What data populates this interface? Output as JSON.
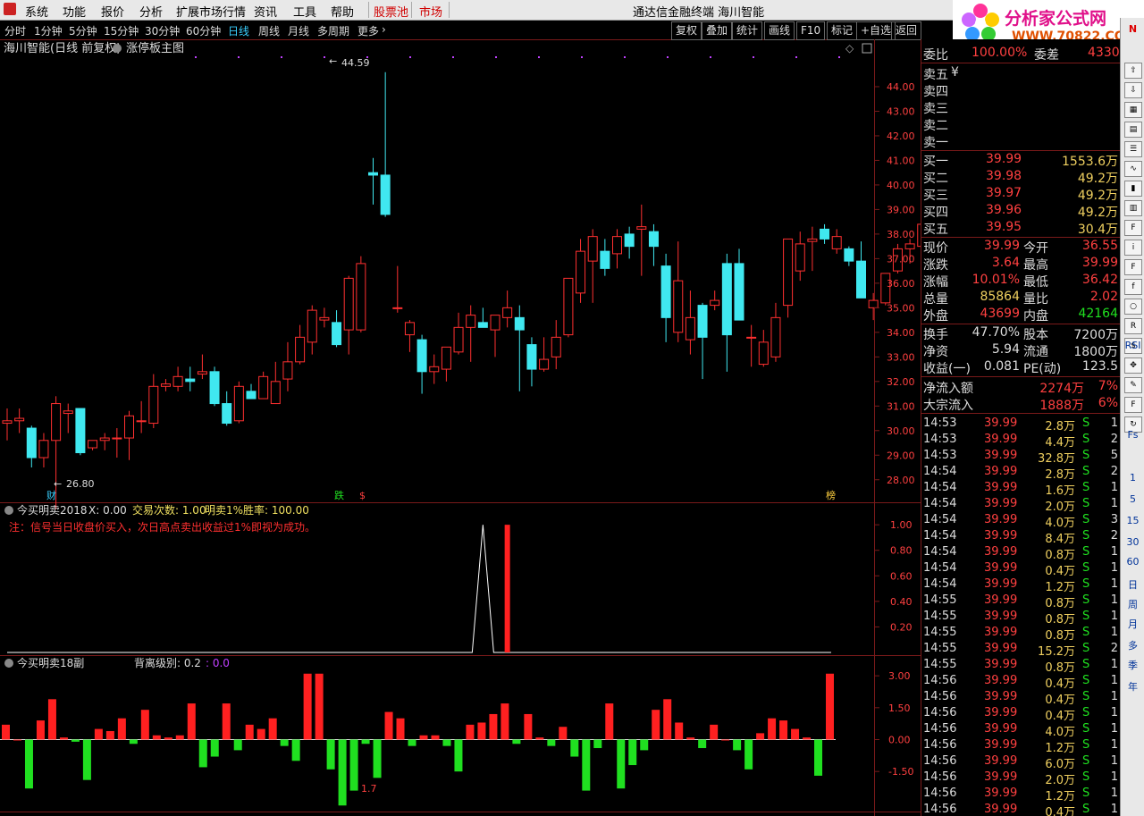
{
  "menu": {
    "items": [
      "系统",
      "功能",
      "报价",
      "分析",
      "扩展市场行情",
      "资讯",
      "工具",
      "帮助"
    ],
    "stock_pool": "股票池",
    "market": "市场",
    "title": "通达信金融终端 海川智能",
    "trade": "行"
  },
  "logo": {
    "title": "分析家公式网",
    "url": "WWW.70822.COM"
  },
  "period_bar": {
    "periods": [
      "分时",
      "1分钟",
      "5分钟",
      "15分钟",
      "30分钟",
      "60分钟",
      "日线",
      "周线",
      "月线",
      "多周期",
      "更多"
    ],
    "active": "日线",
    "buttons": [
      "复权",
      "叠加",
      "统计",
      "画线",
      "F10",
      "标记",
      "+自选",
      "返回"
    ]
  },
  "main_chart": {
    "stock_title": "海川智能(日线 前复权)",
    "template": "涨停板主图",
    "high_label": "44.59",
    "low_label": "26.80",
    "bottom_markers": [
      "财",
      "跌",
      "$",
      "榜"
    ]
  },
  "indicator1": {
    "name": "今买明卖2018",
    "x_label": "X: 0.00",
    "trades_label": "交易次数: 1.00",
    "winrate_label": "明卖1%胜率: 100.00",
    "note": "注：信号当日收盘价买入，次日高点卖出收益过1%即视为成功。",
    "ylabels": [
      "1.00",
      "0.80",
      "0.60",
      "0.40",
      "0.20"
    ]
  },
  "indicator2": {
    "name": "今买明卖18副",
    "level_label": "背离级别: 0.2",
    "level_value": ": 0.0",
    "annotation": "1.7",
    "ylabels": [
      "3.00",
      "1.50",
      "0.00",
      "-1.50"
    ]
  },
  "colors": {
    "up": "#ff3030",
    "down": "#40e8f0",
    "pos_bar": "#ff2020",
    "neg_bar": "#20e020",
    "border": "#7a1a1a"
  },
  "chart_data": [
    {
      "type": "candlestick",
      "title": "海川智能(日线 前复权)",
      "ylim": [
        27.3,
        45.2
      ],
      "yticks": [
        "44.00",
        "43.00",
        "42.00",
        "41.00",
        "40.00",
        "39.00",
        "38.00",
        "37.00",
        "36.00",
        "35.00",
        "34.00",
        "33.00",
        "32.00",
        "31.00",
        "30.00",
        "29.00",
        "28.00"
      ],
      "candles": [
        [
          30.3,
          30.9,
          29.6,
          30.4
        ],
        [
          30.4,
          30.9,
          29.9,
          30.5
        ],
        [
          30.1,
          30.2,
          28.5,
          28.9
        ],
        [
          28.9,
          29.9,
          28.5,
          29.6
        ],
        [
          29.6,
          31.4,
          26.8,
          31.1
        ],
        [
          30.7,
          31.1,
          29.9,
          30.8
        ],
        [
          30.9,
          30.9,
          29.0,
          29.1
        ],
        [
          29.3,
          29.6,
          29.2,
          29.6
        ],
        [
          29.6,
          29.9,
          29.2,
          29.7
        ],
        [
          29.7,
          30.1,
          28.9,
          29.7
        ],
        [
          29.7,
          30.8,
          28.8,
          30.6
        ],
        [
          30.4,
          31.2,
          29.9,
          30.4
        ],
        [
          30.3,
          32.3,
          30.1,
          31.8
        ],
        [
          31.8,
          32.1,
          31.6,
          31.9
        ],
        [
          31.8,
          32.6,
          31.6,
          32.2
        ],
        [
          32.1,
          32.6,
          31.6,
          32.0
        ],
        [
          32.3,
          33.1,
          32.1,
          32.4
        ],
        [
          32.4,
          32.6,
          31.0,
          31.1
        ],
        [
          31.1,
          31.6,
          30.2,
          30.3
        ],
        [
          30.4,
          32.0,
          30.3,
          31.8
        ],
        [
          31.6,
          31.9,
          31.4,
          31.3
        ],
        [
          31.3,
          32.4,
          31.3,
          32.2
        ],
        [
          31.1,
          32.8,
          31.2,
          32.0
        ],
        [
          32.1,
          33.6,
          31.6,
          32.8
        ],
        [
          32.8,
          34.3,
          32.7,
          33.8
        ],
        [
          33.6,
          35.1,
          33.1,
          34.9
        ],
        [
          34.5,
          35.0,
          34.2,
          34.6
        ],
        [
          34.4,
          34.9,
          33.4,
          33.5
        ],
        [
          34.1,
          36.3,
          33.1,
          36.2
        ],
        [
          34.1,
          37.1,
          34.0,
          36.8
        ],
        [
          40.5,
          41.1,
          39.2,
          40.4
        ],
        [
          40.4,
          44.59,
          38.7,
          38.8
        ],
        [
          35.0,
          36.7,
          34.8,
          35.0
        ],
        [
          33.9,
          34.5,
          33.2,
          34.4
        ],
        [
          33.7,
          33.9,
          31.5,
          32.4
        ],
        [
          32.4,
          33.1,
          31.9,
          32.6
        ],
        [
          32.5,
          32.9,
          32.0,
          33.4
        ],
        [
          33.2,
          34.8,
          33.1,
          34.2
        ],
        [
          34.2,
          35.1,
          32.8,
          34.7
        ],
        [
          34.4,
          35.0,
          34.3,
          34.2
        ],
        [
          34.1,
          34.5,
          33.0,
          34.7
        ],
        [
          34.6,
          35.7,
          34.2,
          35.0
        ],
        [
          34.6,
          35.1,
          31.6,
          34.1
        ],
        [
          33.5,
          33.8,
          31.8,
          32.5
        ],
        [
          32.5,
          33.8,
          32.4,
          32.9
        ],
        [
          33.0,
          34.5,
          32.5,
          33.8
        ],
        [
          33.9,
          36.2,
          33.8,
          36.2
        ],
        [
          35.6,
          37.8,
          35.2,
          37.3
        ],
        [
          36.9,
          38.2,
          35.2,
          37.9
        ],
        [
          37.3,
          37.8,
          36.3,
          36.6
        ],
        [
          37.2,
          38.2,
          36.6,
          37.9
        ],
        [
          38.0,
          38.3,
          37.0,
          37.5
        ],
        [
          38.2,
          39.2,
          36.3,
          38.3
        ],
        [
          38.1,
          38.4,
          36.7,
          37.5
        ],
        [
          36.7,
          37.2,
          33.6,
          34.6
        ],
        [
          34.0,
          37.7,
          33.6,
          36.1
        ],
        [
          33.7,
          35.7,
          33.1,
          34.6
        ],
        [
          35.1,
          35.2,
          32.1,
          33.8
        ],
        [
          35.1,
          35.7,
          34.9,
          35.3
        ],
        [
          36.8,
          37.2,
          32.4,
          33.9
        ],
        [
          36.8,
          37.4,
          34.5,
          34.5
        ],
        [
          33.8,
          34.3,
          32.6,
          33.8
        ],
        [
          32.7,
          34.1,
          32.6,
          33.6
        ],
        [
          33.0,
          35.2,
          32.8,
          34.6
        ],
        [
          35.1,
          37.7,
          34.6,
          37.8
        ],
        [
          36.5,
          38.1,
          36.1,
          37.6
        ],
        [
          37.7,
          38.3,
          36.5,
          37.8
        ],
        [
          38.2,
          38.4,
          37.6,
          37.8
        ],
        [
          37.4,
          38.2,
          37.2,
          37.9
        ],
        [
          37.4,
          37.5,
          36.7,
          36.9
        ],
        [
          36.9,
          37.7,
          35.5,
          35.4
        ],
        [
          35.0,
          35.6,
          34.5,
          35.3
        ],
        [
          35.2,
          36.4,
          35.1,
          36.4
        ],
        [
          36.5,
          37.6,
          36.4,
          37.4
        ],
        [
          37.4,
          37.8,
          36.8,
          37.6
        ],
        [
          37.5,
          39.8,
          37.3,
          38.4
        ],
        [
          38.4,
          39.5,
          36.1,
          36.4
        ],
        [
          36.5,
          40.0,
          36.5,
          40.0
        ]
      ]
    },
    {
      "type": "line",
      "title": "今买明卖2018",
      "ylim": [
        0,
        1.05
      ],
      "peak_index": 39,
      "peak_value": 1.0,
      "red_bar_index": 41,
      "red_bar_value": 1.0
    },
    {
      "type": "bar",
      "title": "今买明卖18副",
      "ylim": [
        -3.3,
        3.3
      ],
      "values": [
        0.7,
        0.0,
        -2.3,
        0.9,
        1.9,
        0.1,
        -0.1,
        -1.9,
        0.5,
        0.4,
        1.0,
        -0.2,
        1.4,
        0.2,
        0.1,
        0.2,
        1.7,
        -1.3,
        -0.8,
        1.7,
        -0.5,
        0.7,
        0.5,
        1.0,
        -0.3,
        -1.0,
        3.1,
        3.1,
        -1.4,
        -3.1,
        -2.4,
        -0.2,
        -1.8,
        1.3,
        1.0,
        -0.3,
        0.2,
        0.2,
        -0.3,
        -1.5,
        0.7,
        0.8,
        1.2,
        1.7,
        -0.2,
        1.2,
        0.1,
        -0.3,
        0.6,
        -0.8,
        -2.4,
        -0.4,
        1.7,
        -2.3,
        -1.2,
        -0.5,
        1.4,
        1.9,
        0.8,
        0.1,
        -0.4,
        0.7,
        0.0,
        -0.5,
        -1.4,
        0.3,
        1.0,
        0.9,
        0.5,
        0.1,
        -1.7,
        3.1
      ]
    }
  ],
  "quote": {
    "weibi_label": "委比",
    "weibi_value": "100.00%",
    "weicha_label": "委差",
    "weicha_value": "4330",
    "sells": [
      {
        "label": "卖五",
        "extra": "¥"
      },
      {
        "label": "卖四"
      },
      {
        "label": "卖三"
      },
      {
        "label": "卖二"
      },
      {
        "label": "卖一"
      }
    ],
    "buys": [
      {
        "label": "买一",
        "price": "39.99",
        "vol": "1553.6万"
      },
      {
        "label": "买二",
        "price": "39.98",
        "vol": "49.2万"
      },
      {
        "label": "买三",
        "price": "39.97",
        "vol": "49.2万"
      },
      {
        "label": "买四",
        "price": "39.96",
        "vol": "49.2万"
      },
      {
        "label": "买五",
        "price": "39.95",
        "vol": "30.4万"
      }
    ],
    "stats": [
      {
        "l1": "现价",
        "v1": "39.99",
        "c1": "red",
        "l2": "今开",
        "v2": "36.55",
        "c2": "red"
      },
      {
        "l1": "涨跌",
        "v1": "3.64",
        "c1": "red",
        "l2": "最高",
        "v2": "39.99",
        "c2": "red"
      },
      {
        "l1": "涨幅",
        "v1": "10.01%",
        "c1": "red",
        "l2": "最低",
        "v2": "36.42",
        "c2": "red"
      },
      {
        "l1": "总量",
        "v1": "85864",
        "c1": "yel",
        "l2": "量比",
        "v2": "2.02",
        "c2": "red"
      },
      {
        "l1": "外盘",
        "v1": "43699",
        "c1": "red",
        "l2": "内盘",
        "v2": "42164",
        "c2": "grn"
      }
    ],
    "stats2": [
      {
        "l1": "换手",
        "v1": "47.70%",
        "l2": "股本",
        "v2": "7200万"
      },
      {
        "l1": "净资",
        "v1": "5.94",
        "l2": "流通",
        "v2": "1800万"
      },
      {
        "l1": "收益(一)",
        "v1": "0.081",
        "l2": "PE(动)",
        "v2": "123.5"
      }
    ],
    "flows": [
      {
        "label": "净流入额",
        "value": "2274万",
        "pct": "7%"
      },
      {
        "label": "大宗流入",
        "value": "1888万",
        "pct": "6%"
      }
    ]
  },
  "ticks": [
    {
      "t": "14:53",
      "p": "39.99",
      "v": "2.8万",
      "s": "S",
      "n": "1"
    },
    {
      "t": "14:53",
      "p": "39.99",
      "v": "4.4万",
      "s": "S",
      "n": "2"
    },
    {
      "t": "14:53",
      "p": "39.99",
      "v": "32.8万",
      "s": "S",
      "n": "5"
    },
    {
      "t": "14:54",
      "p": "39.99",
      "v": "2.8万",
      "s": "S",
      "n": "2"
    },
    {
      "t": "14:54",
      "p": "39.99",
      "v": "1.6万",
      "s": "S",
      "n": "1"
    },
    {
      "t": "14:54",
      "p": "39.99",
      "v": "2.0万",
      "s": "S",
      "n": "1"
    },
    {
      "t": "14:54",
      "p": "39.99",
      "v": "4.0万",
      "s": "S",
      "n": "3"
    },
    {
      "t": "14:54",
      "p": "39.99",
      "v": "8.4万",
      "s": "S",
      "n": "2"
    },
    {
      "t": "14:54",
      "p": "39.99",
      "v": "0.8万",
      "s": "S",
      "n": "1"
    },
    {
      "t": "14:54",
      "p": "39.99",
      "v": "0.4万",
      "s": "S",
      "n": "1"
    },
    {
      "t": "14:54",
      "p": "39.99",
      "v": "1.2万",
      "s": "S",
      "n": "1"
    },
    {
      "t": "14:55",
      "p": "39.99",
      "v": "0.8万",
      "s": "S",
      "n": "1"
    },
    {
      "t": "14:55",
      "p": "39.99",
      "v": "0.8万",
      "s": "S",
      "n": "1"
    },
    {
      "t": "14:55",
      "p": "39.99",
      "v": "0.8万",
      "s": "S",
      "n": "1"
    },
    {
      "t": "14:55",
      "p": "39.99",
      "v": "15.2万",
      "s": "S",
      "n": "2"
    },
    {
      "t": "14:55",
      "p": "39.99",
      "v": "0.8万",
      "s": "S",
      "n": "1"
    },
    {
      "t": "14:56",
      "p": "39.99",
      "v": "0.4万",
      "s": "S",
      "n": "1"
    },
    {
      "t": "14:56",
      "p": "39.99",
      "v": "0.4万",
      "s": "S",
      "n": "1"
    },
    {
      "t": "14:56",
      "p": "39.99",
      "v": "0.4万",
      "s": "S",
      "n": "1"
    },
    {
      "t": "14:56",
      "p": "39.99",
      "v": "4.0万",
      "s": "S",
      "n": "1"
    },
    {
      "t": "14:56",
      "p": "39.99",
      "v": "1.2万",
      "s": "S",
      "n": "1"
    },
    {
      "t": "14:56",
      "p": "39.99",
      "v": "6.0万",
      "s": "S",
      "n": "1"
    },
    {
      "t": "14:56",
      "p": "39.99",
      "v": "2.0万",
      "s": "S",
      "n": "1"
    },
    {
      "t": "14:56",
      "p": "39.99",
      "v": "1.2万",
      "s": "S",
      "n": "1"
    },
    {
      "t": "14:56",
      "p": "39.99",
      "v": "0.4万",
      "s": "S",
      "n": "1"
    }
  ],
  "toolbar": {
    "labels": [
      "N",
      "RSI",
      "Fs",
      "1",
      "5",
      "15",
      "30",
      "60",
      "日",
      "周",
      "月",
      "多",
      "季",
      "年"
    ],
    "icons": [
      "up-arrow-icon",
      "down-arrow-icon",
      "chart-icon",
      "table-icon",
      "list-icon",
      "line-chart-icon",
      "kline-icon",
      "grid-icon",
      "f10-icon",
      "info-icon",
      "fiz-icon",
      "f10s-icon",
      "circle-icon",
      "rsi-icon",
      "dollar-icon",
      "move-icon",
      "pen-icon",
      "fs-icon",
      "refresh-icon"
    ]
  }
}
